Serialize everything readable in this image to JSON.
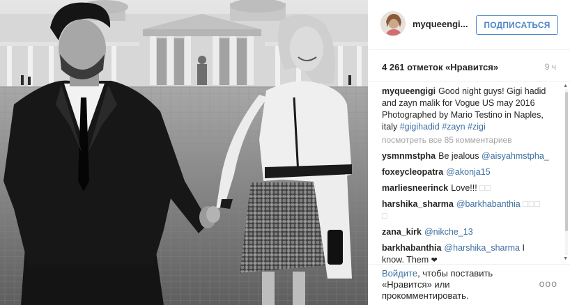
{
  "post": {
    "username": "myqueengi...",
    "follow_label": "ПОДПИСАТЬСЯ",
    "likes_text": "4 261 отметок «Нравится»",
    "time_text": "9 ч"
  },
  "caption": {
    "username": "myqueengigi",
    "text": "Good night guys! Gigi hadid and zayn malik for Vogue US may 2016 Photographed by Mario Testino in Naples, italy",
    "hashtags": [
      "#gigihadid",
      "#zayn",
      "#zigi"
    ]
  },
  "view_all_comments": "посмотреть все 85 комментариев",
  "comments": [
    {
      "username": "ysmnmstpha",
      "text": "Be jealous",
      "mention": "@aisyahmstpha_"
    },
    {
      "username": "foxeycleopatra",
      "mention": "@akonja15"
    },
    {
      "username": "marliesneerinck",
      "text": "Love!!!",
      "glyph": "□□"
    },
    {
      "username": "harshika_sharma",
      "mention": "@barkhabanthia",
      "glyph": "□□□",
      "glyph2": "□"
    },
    {
      "username": "zana_kirk",
      "mention": "@nikche_13"
    },
    {
      "username": "barkhabanthia",
      "mention": "@harshika_sharma",
      "text": "I know. Them",
      "emoji": "❤"
    }
  ],
  "footer": {
    "login_link": "Войдите",
    "login_rest": ", чтобы поставить «Нравится» или прокомментировать.",
    "more_label": "ooo"
  },
  "icons": {
    "avatar": "profile-avatar",
    "more": "more-options-icon",
    "heart": "heart-emoji"
  },
  "colors": {
    "follow_blue": "#4a87c8",
    "link_blue": "#3d6fa3",
    "muted_gray": "#a5a5a5"
  }
}
